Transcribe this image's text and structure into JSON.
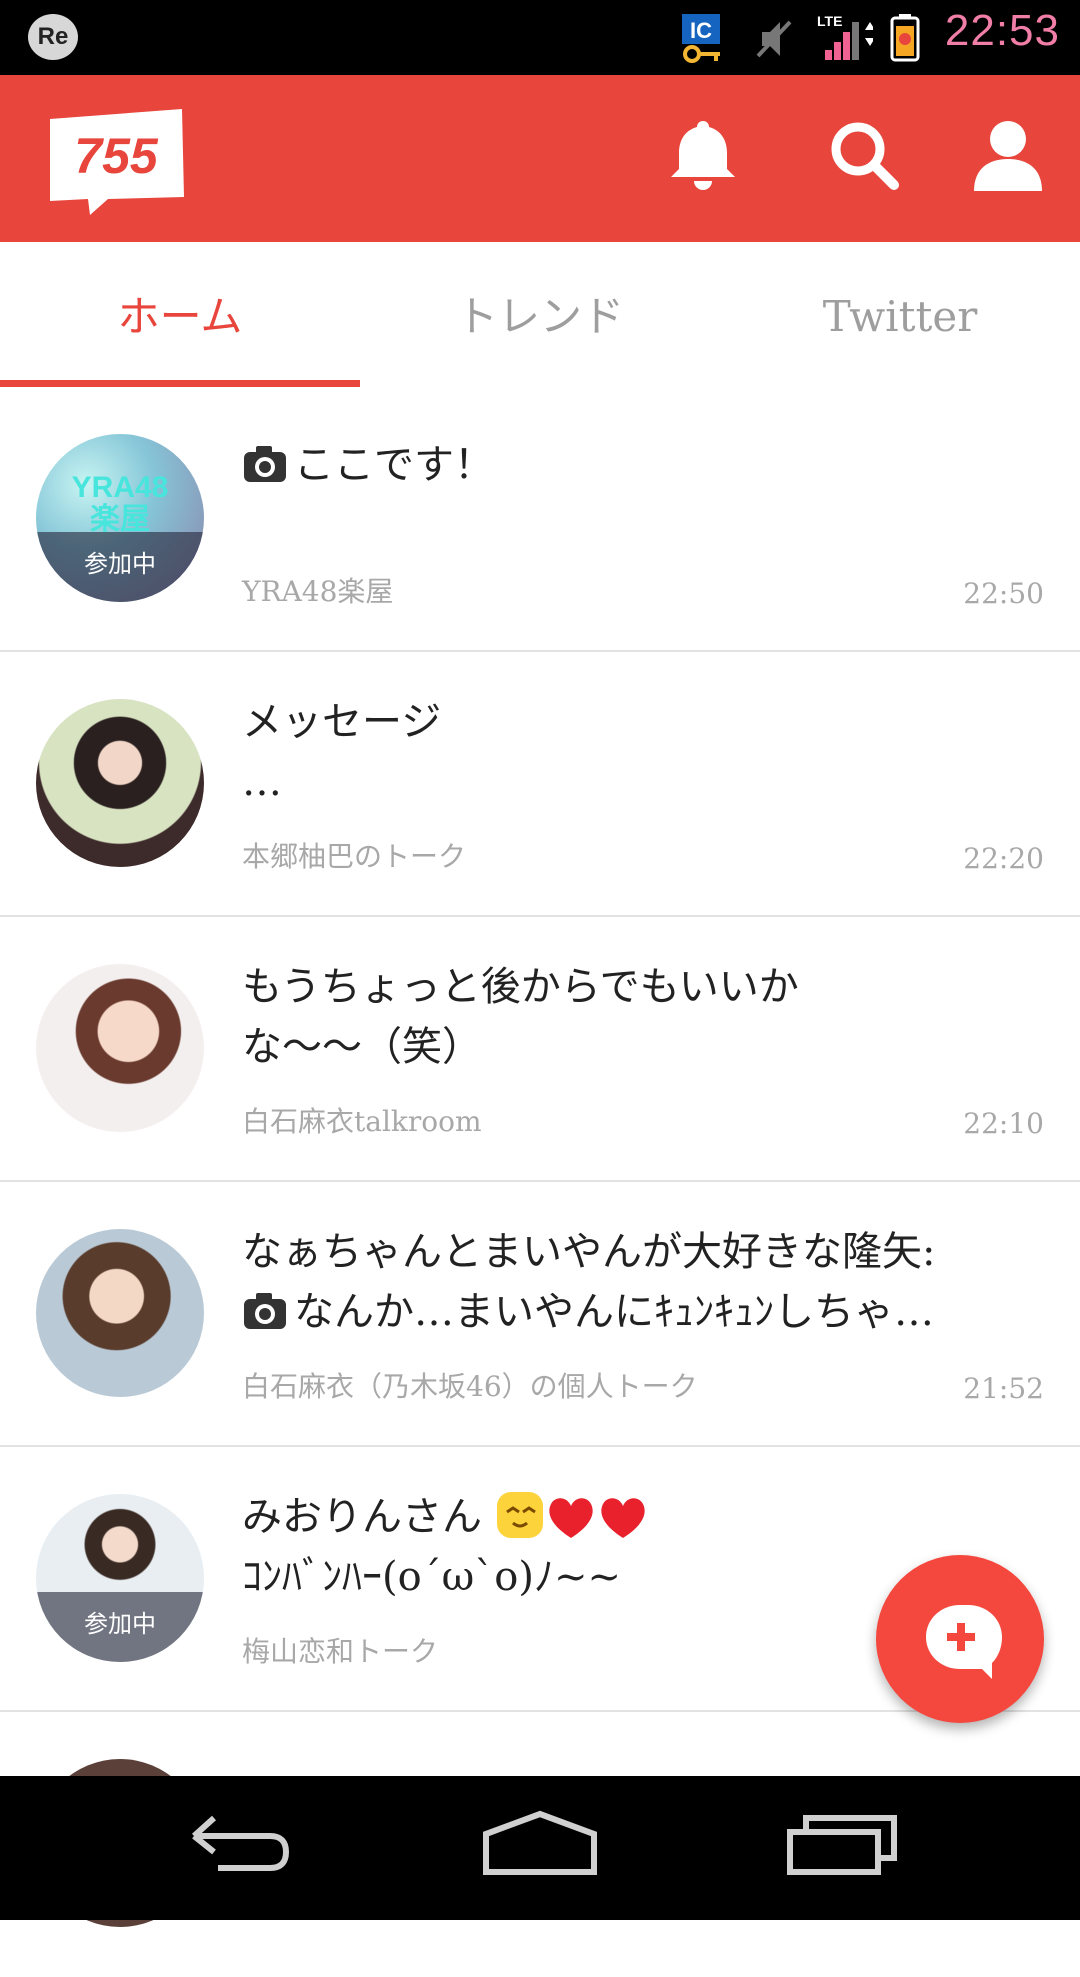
{
  "status_bar": {
    "re_badge": "Re",
    "ic_badge": "IC",
    "network": "LTE",
    "time": "22:53"
  },
  "app_bar": {
    "logo_text": "755",
    "icons": [
      "bell-icon",
      "search-icon",
      "profile-icon"
    ]
  },
  "tabs": [
    {
      "label": "ホーム",
      "active": true
    },
    {
      "label": "トレンド",
      "active": false
    },
    {
      "label": "Twitter",
      "active": false
    }
  ],
  "feed": [
    {
      "avatar_text": "YRA48\n楽屋",
      "badge": "参加中",
      "message_lines": [
        "ここです！"
      ],
      "has_camera": true,
      "room": "YRA48楽屋",
      "time": "22:50"
    },
    {
      "badge": "",
      "message_lines": [
        "メッセージ",
        "…"
      ],
      "room": "本郷柚巴のトーク",
      "time": "22:20"
    },
    {
      "badge": "",
      "message_lines": [
        "もうちょっと後からでもいいか",
        "な〜〜（笑）"
      ],
      "room": "白石麻衣talkroom",
      "time": "22:10"
    },
    {
      "badge": "",
      "message_lines": [
        "なぁちゃんとまいやんが大好きな隆矢:",
        "なんか…まいやんにｷｭﾝｷｭﾝしちゃ…"
      ],
      "has_camera_line2": true,
      "room": "白石麻衣（乃木坂46）の個人トーク",
      "time": "21:52"
    },
    {
      "badge": "参加中",
      "message_lines": [
        "みおりんさん",
        "ｺﾝﾊﾞﾝﾊｰ(o´ω`o)ﾉ~~"
      ],
      "emoji": [
        "smiling-face-emoji",
        "heart-emoji",
        "heart-emoji"
      ],
      "room": "梅山恋和トーク",
      "time": ""
    }
  ],
  "fab": {
    "icon": "new-chat-icon"
  },
  "nav_bar": {
    "icons": [
      "back-icon",
      "home-icon",
      "recents-icon"
    ]
  },
  "colors": {
    "accent": "#e8453c",
    "secondary_text": "#a8a8a8",
    "clock": "#f07ea6"
  }
}
